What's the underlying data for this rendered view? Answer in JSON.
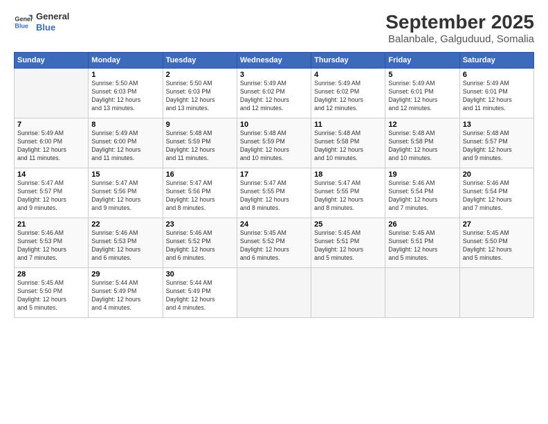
{
  "header": {
    "logo_line1": "General",
    "logo_line2": "Blue",
    "month": "September 2025",
    "location": "Balanbale, Galguduud, Somalia"
  },
  "days_of_week": [
    "Sunday",
    "Monday",
    "Tuesday",
    "Wednesday",
    "Thursday",
    "Friday",
    "Saturday"
  ],
  "weeks": [
    [
      {
        "day": "",
        "content": ""
      },
      {
        "day": "1",
        "content": "Sunrise: 5:50 AM\nSunset: 6:03 PM\nDaylight: 12 hours\nand 13 minutes."
      },
      {
        "day": "2",
        "content": "Sunrise: 5:50 AM\nSunset: 6:03 PM\nDaylight: 12 hours\nand 13 minutes."
      },
      {
        "day": "3",
        "content": "Sunrise: 5:49 AM\nSunset: 6:02 PM\nDaylight: 12 hours\nand 12 minutes."
      },
      {
        "day": "4",
        "content": "Sunrise: 5:49 AM\nSunset: 6:02 PM\nDaylight: 12 hours\nand 12 minutes."
      },
      {
        "day": "5",
        "content": "Sunrise: 5:49 AM\nSunset: 6:01 PM\nDaylight: 12 hours\nand 12 minutes."
      },
      {
        "day": "6",
        "content": "Sunrise: 5:49 AM\nSunset: 6:01 PM\nDaylight: 12 hours\nand 11 minutes."
      }
    ],
    [
      {
        "day": "7",
        "content": "Sunrise: 5:49 AM\nSunset: 6:00 PM\nDaylight: 12 hours\nand 11 minutes."
      },
      {
        "day": "8",
        "content": "Sunrise: 5:49 AM\nSunset: 6:00 PM\nDaylight: 12 hours\nand 11 minutes."
      },
      {
        "day": "9",
        "content": "Sunrise: 5:48 AM\nSunset: 5:59 PM\nDaylight: 12 hours\nand 11 minutes."
      },
      {
        "day": "10",
        "content": "Sunrise: 5:48 AM\nSunset: 5:59 PM\nDaylight: 12 hours\nand 10 minutes."
      },
      {
        "day": "11",
        "content": "Sunrise: 5:48 AM\nSunset: 5:58 PM\nDaylight: 12 hours\nand 10 minutes."
      },
      {
        "day": "12",
        "content": "Sunrise: 5:48 AM\nSunset: 5:58 PM\nDaylight: 12 hours\nand 10 minutes."
      },
      {
        "day": "13",
        "content": "Sunrise: 5:48 AM\nSunset: 5:57 PM\nDaylight: 12 hours\nand 9 minutes."
      }
    ],
    [
      {
        "day": "14",
        "content": "Sunrise: 5:47 AM\nSunset: 5:57 PM\nDaylight: 12 hours\nand 9 minutes."
      },
      {
        "day": "15",
        "content": "Sunrise: 5:47 AM\nSunset: 5:56 PM\nDaylight: 12 hours\nand 9 minutes."
      },
      {
        "day": "16",
        "content": "Sunrise: 5:47 AM\nSunset: 5:56 PM\nDaylight: 12 hours\nand 8 minutes."
      },
      {
        "day": "17",
        "content": "Sunrise: 5:47 AM\nSunset: 5:55 PM\nDaylight: 12 hours\nand 8 minutes."
      },
      {
        "day": "18",
        "content": "Sunrise: 5:47 AM\nSunset: 5:55 PM\nDaylight: 12 hours\nand 8 minutes."
      },
      {
        "day": "19",
        "content": "Sunrise: 5:46 AM\nSunset: 5:54 PM\nDaylight: 12 hours\nand 7 minutes."
      },
      {
        "day": "20",
        "content": "Sunrise: 5:46 AM\nSunset: 5:54 PM\nDaylight: 12 hours\nand 7 minutes."
      }
    ],
    [
      {
        "day": "21",
        "content": "Sunrise: 5:46 AM\nSunset: 5:53 PM\nDaylight: 12 hours\nand 7 minutes."
      },
      {
        "day": "22",
        "content": "Sunrise: 5:46 AM\nSunset: 5:53 PM\nDaylight: 12 hours\nand 6 minutes."
      },
      {
        "day": "23",
        "content": "Sunrise: 5:46 AM\nSunset: 5:52 PM\nDaylight: 12 hours\nand 6 minutes."
      },
      {
        "day": "24",
        "content": "Sunrise: 5:45 AM\nSunset: 5:52 PM\nDaylight: 12 hours\nand 6 minutes."
      },
      {
        "day": "25",
        "content": "Sunrise: 5:45 AM\nSunset: 5:51 PM\nDaylight: 12 hours\nand 5 minutes."
      },
      {
        "day": "26",
        "content": "Sunrise: 5:45 AM\nSunset: 5:51 PM\nDaylight: 12 hours\nand 5 minutes."
      },
      {
        "day": "27",
        "content": "Sunrise: 5:45 AM\nSunset: 5:50 PM\nDaylight: 12 hours\nand 5 minutes."
      }
    ],
    [
      {
        "day": "28",
        "content": "Sunrise: 5:45 AM\nSunset: 5:50 PM\nDaylight: 12 hours\nand 5 minutes."
      },
      {
        "day": "29",
        "content": "Sunrise: 5:44 AM\nSunset: 5:49 PM\nDaylight: 12 hours\nand 4 minutes."
      },
      {
        "day": "30",
        "content": "Sunrise: 5:44 AM\nSunset: 5:49 PM\nDaylight: 12 hours\nand 4 minutes."
      },
      {
        "day": "",
        "content": ""
      },
      {
        "day": "",
        "content": ""
      },
      {
        "day": "",
        "content": ""
      },
      {
        "day": "",
        "content": ""
      }
    ]
  ]
}
